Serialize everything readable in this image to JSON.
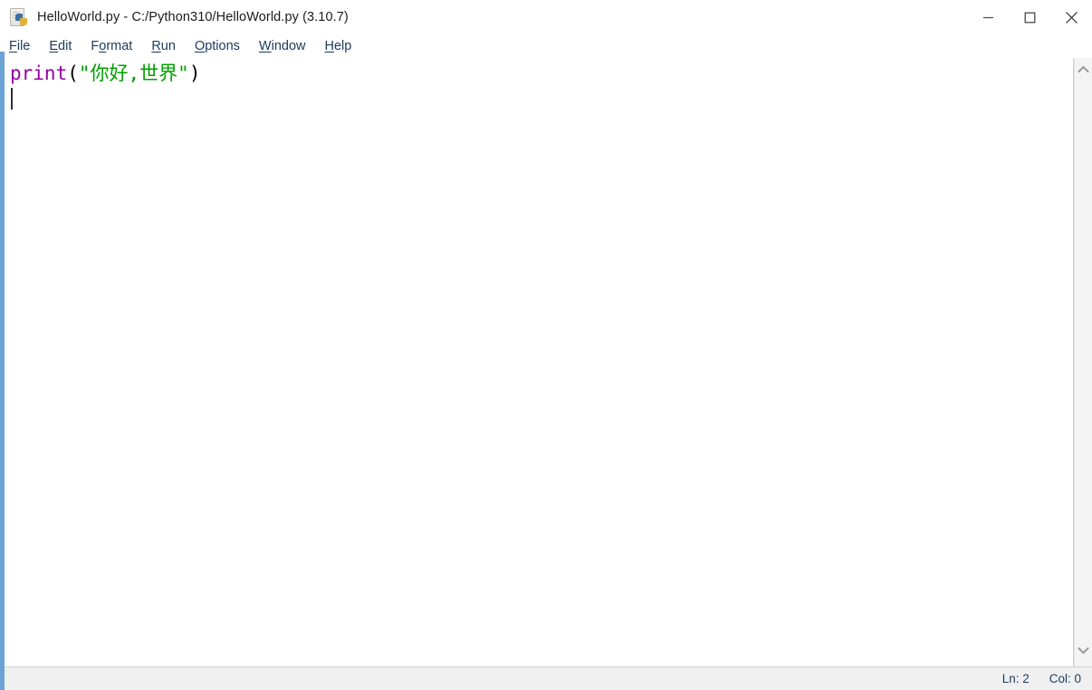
{
  "window": {
    "title": "HelloWorld.py - C:/Python310/HelloWorld.py (3.10.7)",
    "app_icon": "python-file-icon",
    "controls": {
      "minimize": "Minimize",
      "maximize": "Maximize",
      "close": "Close"
    }
  },
  "menubar": {
    "items": [
      {
        "label": "File",
        "mnemonic_index": 0
      },
      {
        "label": "Edit",
        "mnemonic_index": 0
      },
      {
        "label": "Format",
        "mnemonic_index": 1
      },
      {
        "label": "Run",
        "mnemonic_index": 0
      },
      {
        "label": "Options",
        "mnemonic_index": 0
      },
      {
        "label": "Window",
        "mnemonic_index": 0
      },
      {
        "label": "Help",
        "mnemonic_index": 0
      }
    ]
  },
  "editor": {
    "line_1": {
      "builtin": "print",
      "open_paren": "(",
      "string": "\"你好,世界\"",
      "close_paren": ")"
    },
    "full_text": "print(\"你好,世界\")",
    "cursor_line": 2,
    "cursor_column": 0,
    "colors": {
      "builtin": "#9400a0",
      "string": "#00a000",
      "punctuation": "#000000",
      "background": "#ffffff"
    }
  },
  "scrollbar": {
    "up_arrow": "chevron-up-icon",
    "down_arrow": "chevron-down-icon"
  },
  "statusbar": {
    "line_label": "Ln: 2",
    "col_label": "Col: 0"
  }
}
